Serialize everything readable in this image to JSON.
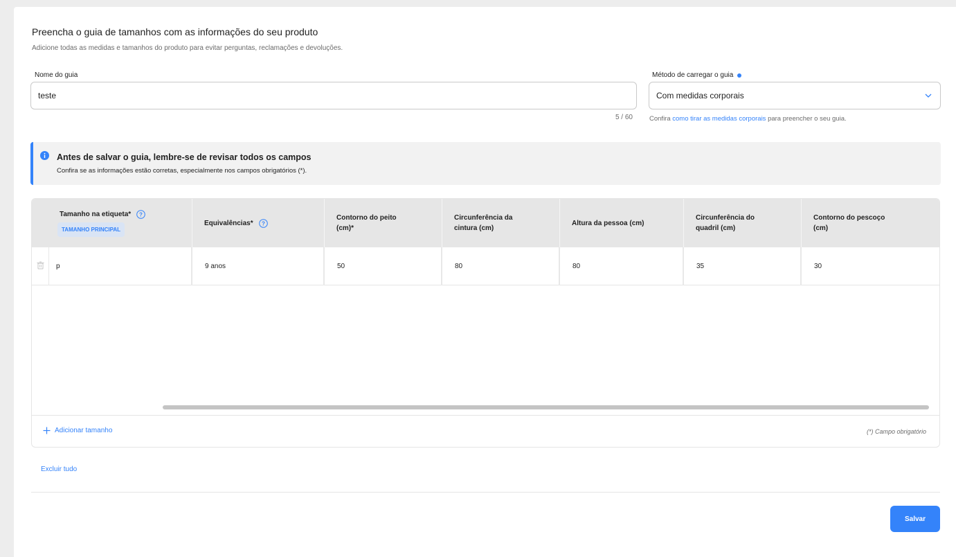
{
  "header": {
    "title": "Preencha o guia de tamanhos com as informações do seu produto",
    "subtitle": "Adicione todas as medidas e tamanhos do produto para evitar perguntas, reclamações e devoluções."
  },
  "guide_name": {
    "label": "Nome do guia",
    "value": "teste",
    "counter": "5 / 60"
  },
  "method": {
    "label": "Método de carregar o guia",
    "value": "Com medidas corporais",
    "helper_prefix": "Confira ",
    "helper_link": "como tirar as medidas corporais",
    "helper_suffix": " para preencher o seu guia."
  },
  "banner": {
    "title": "Antes de salvar o guia, lembre-se de revisar todos os campos",
    "text": "Confira se as informações estão corretas, especialmente nos campos obrigatórios (*)."
  },
  "table": {
    "main_tag": "TAMANHO PRINCIPAL",
    "columns": [
      {
        "label": "Tamanho na etiqueta*",
        "help": true
      },
      {
        "label": "Equivalências*",
        "help": true
      },
      {
        "label": "Contorno do peito (cm)*",
        "help": false
      },
      {
        "label": "Circunferência da cintura (cm)",
        "help": false
      },
      {
        "label": "Altura da pessoa (cm)",
        "help": false
      },
      {
        "label": "Circunferência do quadril (cm)",
        "help": false
      },
      {
        "label": "Contorno do pescoço (cm)",
        "help": false
      }
    ],
    "rows": [
      [
        "p",
        "9 anos",
        "50",
        "80",
        "80",
        "35",
        "30"
      ]
    ],
    "add_label": "Adicionar tamanho",
    "required_note": "(*) Campo obrigatório"
  },
  "actions": {
    "delete_all": "Excluir tudo",
    "save": "Salvar"
  },
  "colors": {
    "accent": "#3483fa",
    "header_bg": "#e6e6e6",
    "banner_bg": "#f2f2f2"
  }
}
